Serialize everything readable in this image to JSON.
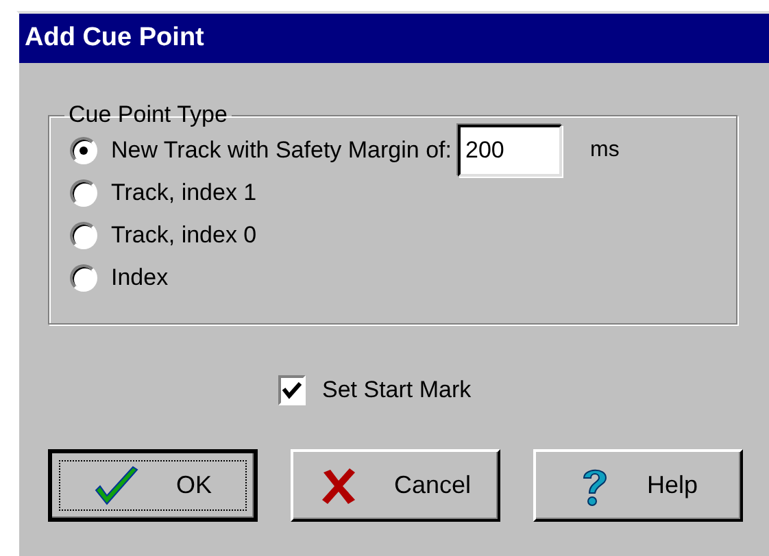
{
  "window": {
    "title": "Add Cue Point"
  },
  "group": {
    "title": "Cue Point Type",
    "options": [
      {
        "label": "New Track with Safety Margin of:",
        "selected": true,
        "field": {
          "value": "200",
          "unit": "ms"
        }
      },
      {
        "label": "Track, index 1",
        "selected": false
      },
      {
        "label": "Track, index 0",
        "selected": false
      },
      {
        "label": "Index",
        "selected": false
      }
    ]
  },
  "checkbox": {
    "label": "Set Start Mark",
    "checked": true
  },
  "buttons": [
    {
      "label": "OK",
      "kind": "ok",
      "default": true
    },
    {
      "label": "Cancel",
      "kind": "cancel",
      "default": false
    },
    {
      "label": "Help",
      "kind": "help",
      "default": false
    }
  ]
}
